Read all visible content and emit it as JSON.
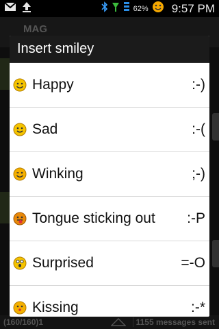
{
  "status_bar": {
    "battery_percent": "62%",
    "time": "9:57 PM"
  },
  "background": {
    "title": "MAG",
    "footer_left": "(160/160)1",
    "footer_right": "1155 messages sent"
  },
  "dialog": {
    "title": "Insert smiley",
    "items": [
      {
        "label": "Happy",
        "code": ":-)",
        "icon": "happy-smiley-icon"
      },
      {
        "label": "Sad",
        "code": ":-(",
        "icon": "sad-smiley-icon"
      },
      {
        "label": "Winking",
        "code": ";-)",
        "icon": "winking-smiley-icon"
      },
      {
        "label": "Tongue sticking out",
        "code": ":-P",
        "icon": "tongue-smiley-icon"
      },
      {
        "label": "Surprised",
        "code": "=-O",
        "icon": "surprised-smiley-icon"
      },
      {
        "label": "Kissing",
        "code": ":-*",
        "icon": "kissing-smiley-icon"
      }
    ]
  },
  "colors": {
    "smiley_yellow": "#f5c400",
    "smiley_orange": "#e8890a",
    "dialog_title_bg": "#1b1b1b",
    "battery_blue": "#2b8fe8"
  }
}
